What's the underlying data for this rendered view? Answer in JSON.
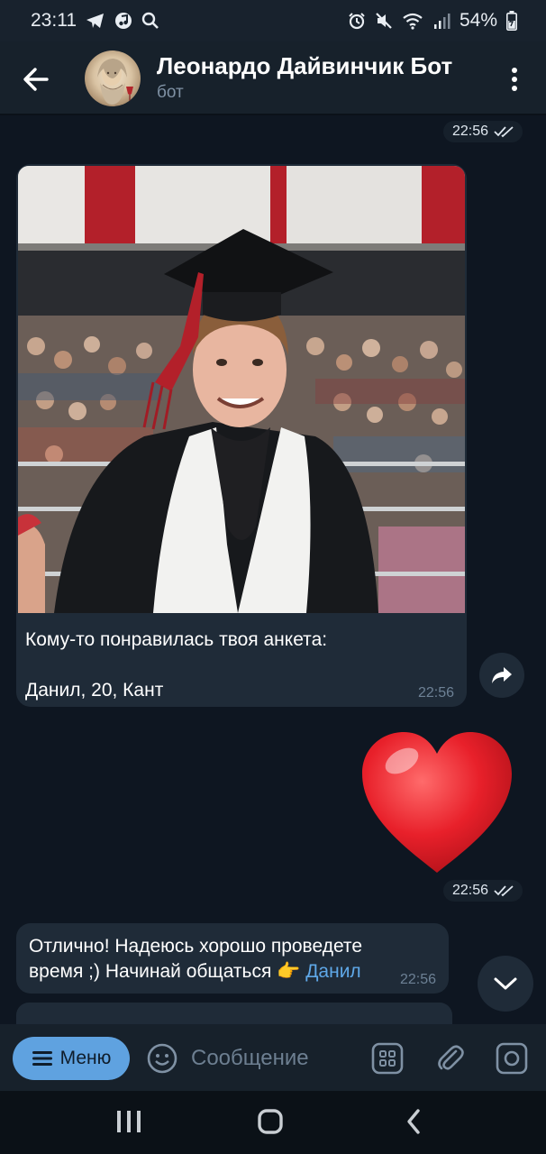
{
  "status_bar": {
    "time": "23:11",
    "battery": "54%",
    "icons": [
      "telegram-icon",
      "music-icon",
      "search-icon",
      "alarm-icon",
      "mute-icon",
      "wifi-icon",
      "signal-icon",
      "battery-icon"
    ]
  },
  "header": {
    "title": "Леонардо Дайвинчик Бот",
    "subtitle": "бот"
  },
  "messages": [
    {
      "type": "outgoing-time",
      "time": "22:56",
      "read": true
    },
    {
      "type": "incoming-photo",
      "line1": "Кому-то понравилась твоя анкета:",
      "line2": "Данил, 20, Кант",
      "time": "22:56"
    },
    {
      "type": "outgoing-emoji",
      "emoji": "heart",
      "time": "22:56",
      "read": true
    },
    {
      "type": "incoming-text",
      "line1": "Отлично! Надеюсь хорошо проведете",
      "line2": "время ;) Начинай общаться",
      "emoji": "👉",
      "mention": "Данил",
      "time": "22:56"
    }
  ],
  "input_bar": {
    "menu_label": "Меню",
    "placeholder": "Сообщение"
  },
  "colors": {
    "background": "#0e1621",
    "header": "#17212b",
    "bubble": "#1f2b38",
    "accent": "#5fa2e0",
    "link": "#5fa8e8"
  }
}
